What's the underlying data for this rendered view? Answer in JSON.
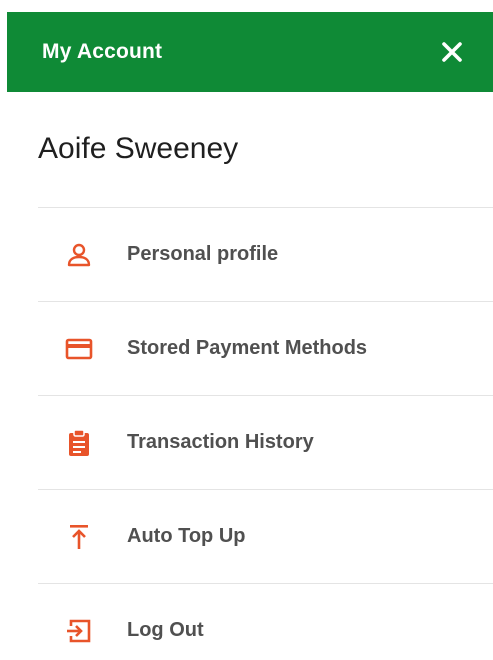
{
  "header": {
    "title": "My Account",
    "close_icon": "close-icon",
    "background_color": "#0f8a36"
  },
  "user": {
    "name": "Aoife Sweeney"
  },
  "accent_color": "#e8542a",
  "menu": {
    "items": [
      {
        "label": "Personal profile",
        "icon": "person-icon"
      },
      {
        "label": "Stored Payment Methods",
        "icon": "credit-card-icon"
      },
      {
        "label": "Transaction History",
        "icon": "clipboard-icon"
      },
      {
        "label": "Auto Top Up",
        "icon": "upload-arrow-icon"
      },
      {
        "label": "Log Out",
        "icon": "logout-icon"
      }
    ]
  }
}
